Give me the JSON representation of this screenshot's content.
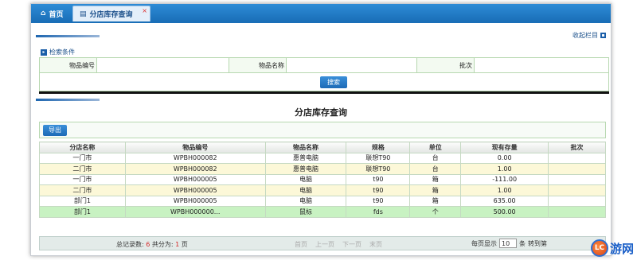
{
  "tabs": {
    "home_label": "首页",
    "active_label": "分店库存查询",
    "close_label": "×"
  },
  "header": {
    "collapse_label": "收起栏目"
  },
  "search": {
    "section_title": "检索条件",
    "fields": [
      {
        "label": "物品编号",
        "value": ""
      },
      {
        "label": "物品名称",
        "value": ""
      },
      {
        "label": "批次",
        "value": ""
      }
    ],
    "button_label": "搜索"
  },
  "page": {
    "title": "分店库存查询"
  },
  "toolbar": {
    "export_label": "导出"
  },
  "grid": {
    "columns": [
      "分店名称",
      "物品编号",
      "物品名称",
      "规格",
      "单位",
      "现有存量",
      "批次"
    ],
    "rows": [
      [
        "一门市",
        "WPBH000082",
        "惠普电脑",
        "联想T90",
        "台",
        "0.00",
        ""
      ],
      [
        "二门市",
        "WPBH000082",
        "惠普电脑",
        "联想T90",
        "台",
        "1.00",
        ""
      ],
      [
        "一门市",
        "WPBH000005",
        "电脑",
        "t90",
        "箱",
        "-111.00",
        ""
      ],
      [
        "二门市",
        "WPBH000005",
        "电脑",
        "t90",
        "箱",
        "1.00",
        ""
      ],
      [
        "部门1",
        "WPBH000005",
        "电脑",
        "t90",
        "箱",
        "635.00",
        ""
      ],
      [
        "部门1",
        "WPBH000000...",
        "鼠标",
        "fds",
        "个",
        "500.00",
        ""
      ]
    ]
  },
  "pager": {
    "total_prefix": "总记录数:",
    "total_records": "6",
    "pages_prefix": "共分为:",
    "total_pages": "1",
    "pages_suffix": "页",
    "first": "首页",
    "prev": "上一页",
    "next": "下一页",
    "last": "末页",
    "per_page_prefix": "每页显示",
    "per_page_value": "10",
    "per_page_suffix": "条",
    "goto_label": "转到第"
  },
  "watermark": {
    "logo_text": "LC",
    "text": "游网"
  }
}
